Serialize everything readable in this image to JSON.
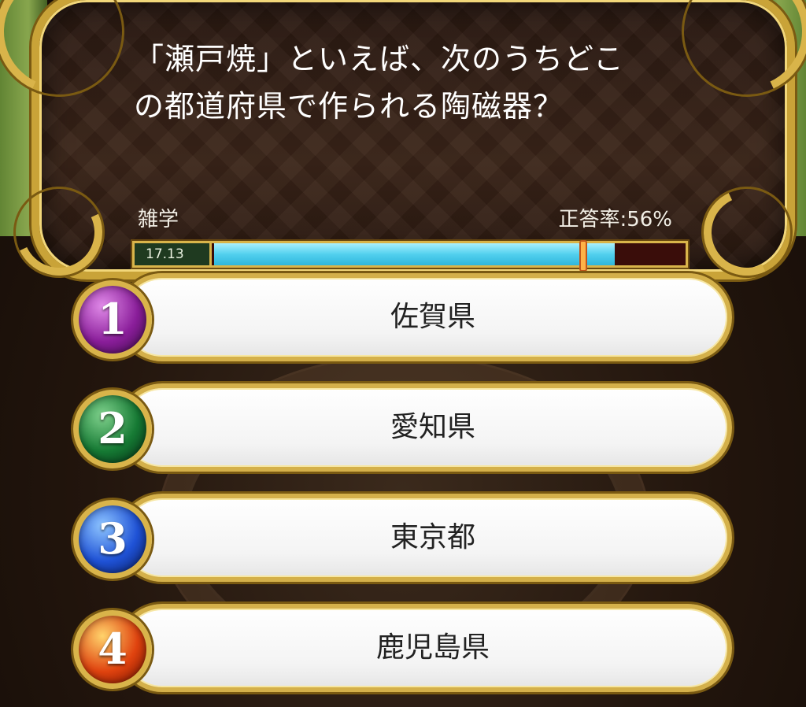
{
  "question": {
    "line1": "「瀬戸焼」といえば、次のうちどこ",
    "line2": "の都道府県で作られる陶磁器？",
    "category": "雑学",
    "correct_rate": "正答率:56%"
  },
  "timer": {
    "label": "17.13",
    "fill_fraction": 0.85,
    "marker_fraction": 0.78,
    "fill_color": "#52d0ee",
    "empty_color": "#3a0d0a"
  },
  "answers": [
    {
      "number": "1",
      "label": "佐賀県",
      "color": "#8a1e9a"
    },
    {
      "number": "2",
      "label": "愛知県",
      "color": "#167a34"
    },
    {
      "number": "3",
      "label": "東京都",
      "color": "#1f52d6"
    },
    {
      "number": "4",
      "label": "鹿児島県",
      "color": "#e0430f"
    }
  ]
}
